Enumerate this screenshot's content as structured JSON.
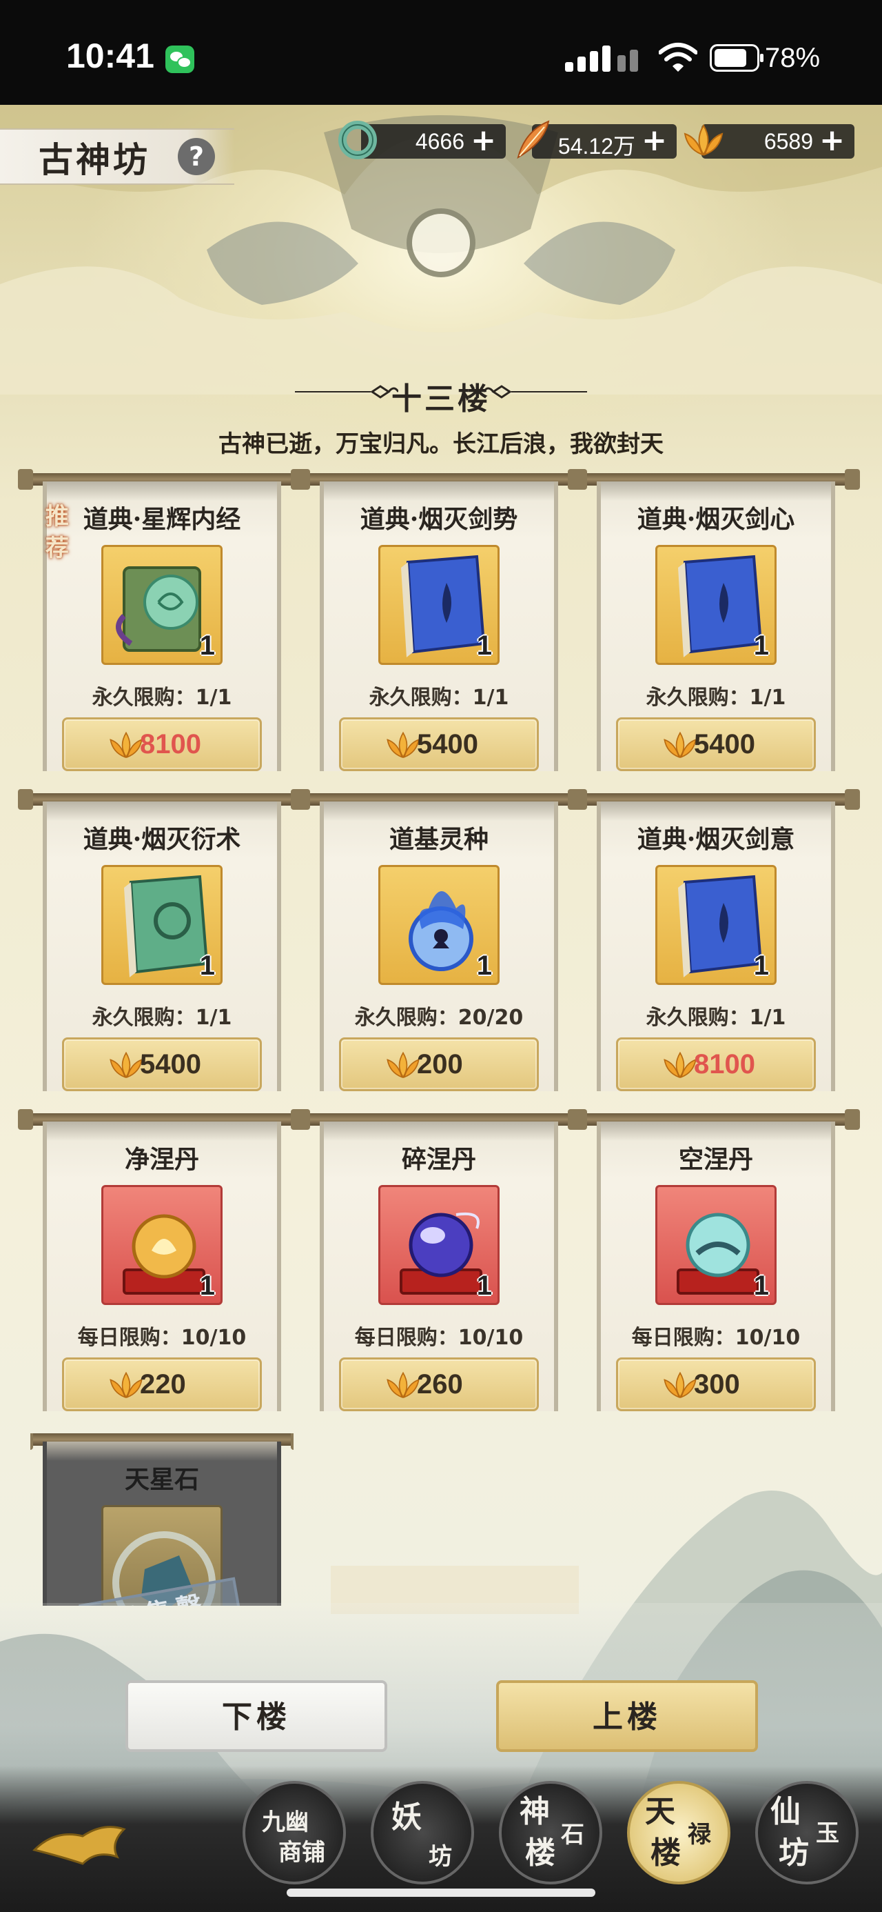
{
  "status_bar": {
    "time": "10:41",
    "battery": "78%"
  },
  "header": {
    "title": "古神坊",
    "help": "?"
  },
  "currencies": [
    {
      "icon": "jade-ring-icon",
      "value": "4666",
      "plus": "+"
    },
    {
      "icon": "feather-icon",
      "value": "54.12万",
      "plus": "+"
    },
    {
      "icon": "lotus-icon",
      "value": "6589",
      "plus": "+"
    }
  ],
  "floor": {
    "title": "十三楼",
    "subtitle": "古神已逝，万宝归凡。长江后浪，我欲封天"
  },
  "items": [
    {
      "name": "道典·星辉内经",
      "qty": "1",
      "limit": "永久限购：1/1",
      "price": "8100",
      "price_red": true,
      "recommend": "推荐",
      "icon": "green-scripture-icon",
      "box": "gold"
    },
    {
      "name": "道典·烟灭剑势",
      "qty": "1",
      "limit": "永久限购：1/1",
      "price": "5400",
      "price_red": false,
      "icon": "blue-book-icon",
      "box": "gold"
    },
    {
      "name": "道典·烟灭剑心",
      "qty": "1",
      "limit": "永久限购：1/1",
      "price": "5400",
      "price_red": false,
      "icon": "blue-book-icon",
      "box": "gold"
    },
    {
      "name": "道典·烟灭衍术",
      "qty": "1",
      "limit": "永久限购：1/1",
      "price": "5400",
      "price_red": false,
      "icon": "green-book-icon",
      "box": "gold"
    },
    {
      "name": "道基灵种",
      "qty": "1",
      "limit": "永久限购：20/20",
      "price": "200",
      "price_red": false,
      "icon": "blue-flame-seed-icon",
      "box": "gold"
    },
    {
      "name": "道典·烟灭剑意",
      "qty": "1",
      "limit": "永久限购：1/1",
      "price": "8100",
      "price_red": true,
      "icon": "blue-book-icon",
      "box": "gold"
    },
    {
      "name": "净涅丹",
      "qty": "1",
      "limit": "每日限购：10/10",
      "price": "220",
      "price_red": false,
      "icon": "golden-orb-icon",
      "box": "red"
    },
    {
      "name": "碎涅丹",
      "qty": "1",
      "limit": "每日限购：10/10",
      "price": "260",
      "price_red": false,
      "icon": "purple-orb-icon",
      "box": "red"
    },
    {
      "name": "空涅丹",
      "qty": "1",
      "limit": "每日限购：10/10",
      "price": "300",
      "price_red": false,
      "icon": "teal-orb-icon",
      "box": "red"
    }
  ],
  "sold_item": {
    "name": "天星石",
    "stamp": "已售罄",
    "icon": "star-stone-icon"
  },
  "buttons": {
    "down": "下楼",
    "up": "上楼"
  },
  "tabs": [
    {
      "l1": "九幽",
      "l2": "商铺",
      "active": false
    },
    {
      "l1": "妖",
      "l2": "坊",
      "active": false
    },
    {
      "l1": "神",
      "l2": "楼",
      "l3": "石",
      "active": false
    },
    {
      "l1": "天",
      "l2": "楼",
      "l3": "禄",
      "active": true
    },
    {
      "l1": "仙",
      "l2": "坊",
      "l3": "玉",
      "active": false
    }
  ],
  "colors": {
    "price_red": "#e0554e",
    "gold_box": "#f4cf6b",
    "red_box": "#f0857a"
  }
}
